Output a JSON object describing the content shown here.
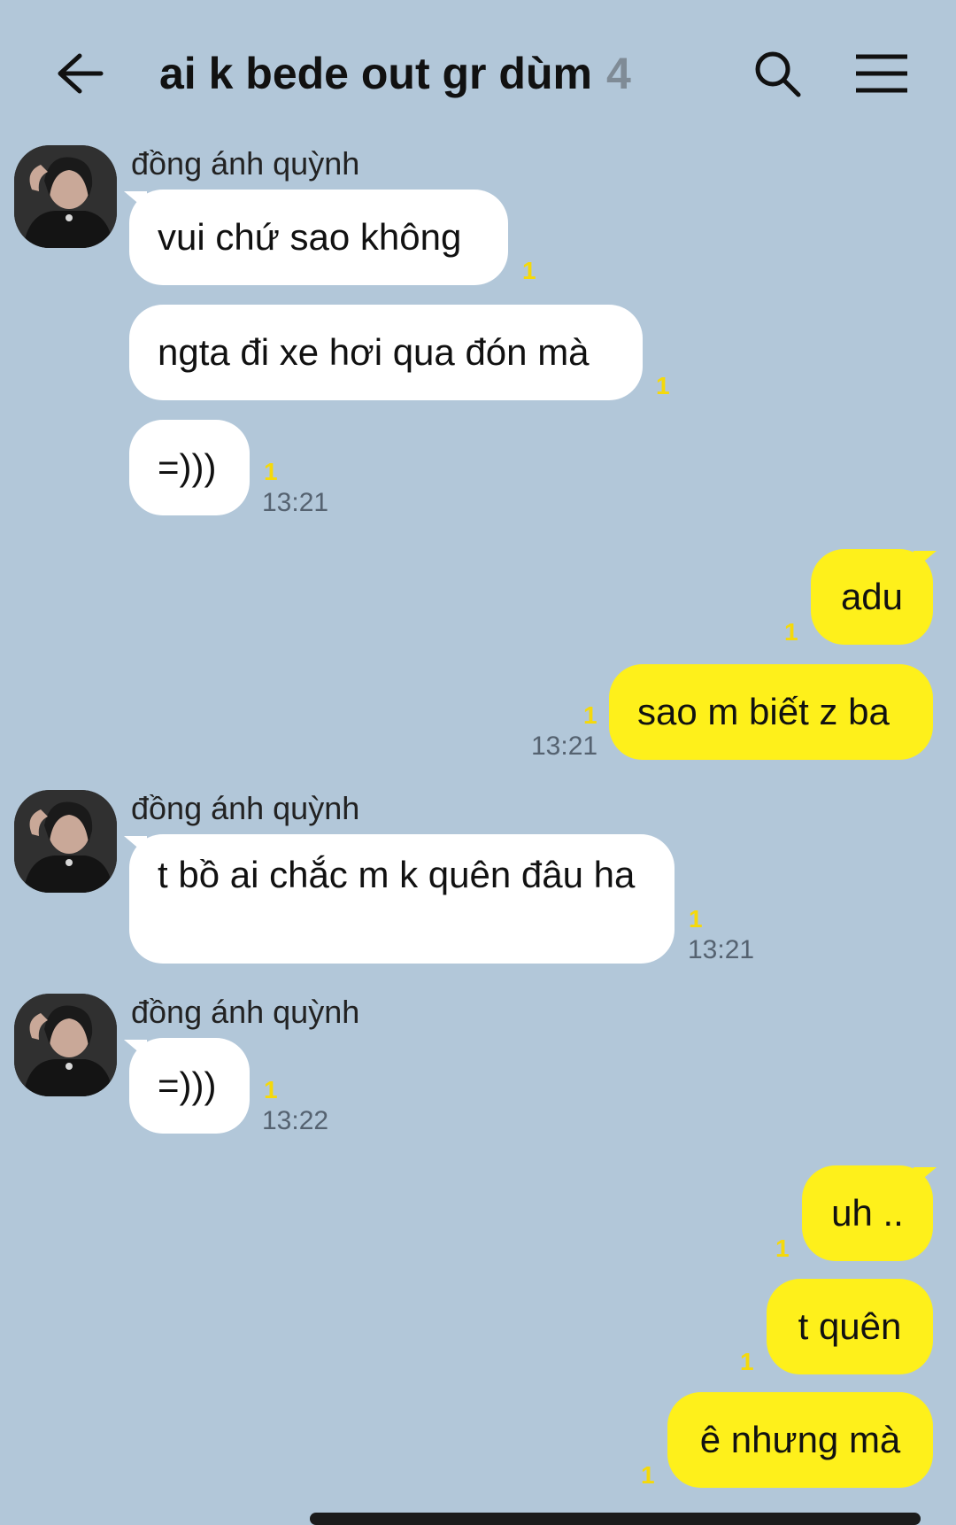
{
  "header": {
    "title": "ai k bede out gr dùm",
    "member_count": "4",
    "icons": {
      "back": "arrow-left-icon",
      "search": "search-icon",
      "menu": "hamburger-menu-icon"
    }
  },
  "colors": {
    "background": "#b2c7d9",
    "incoming_bubble": "#ffffff",
    "outgoing_bubble": "#fef01b",
    "unread_count": "#f5d90a"
  },
  "messages": [
    {
      "direction": "in",
      "sender": "đồng ánh quỳnh",
      "text": "vui chứ sao không",
      "unread": "1"
    },
    {
      "direction": "in",
      "text": "ngta đi xe hơi qua đón mà",
      "unread": "1"
    },
    {
      "direction": "in",
      "text": "=)))",
      "unread": "1",
      "time": "13:21"
    },
    {
      "direction": "out",
      "text": "adu",
      "unread": "1"
    },
    {
      "direction": "out",
      "text": "sao m biết z ba",
      "unread": "1",
      "time": "13:21"
    },
    {
      "direction": "in",
      "sender": "đồng ánh quỳnh",
      "text": "t bồ ai chắc m k quên đâu ha",
      "unread": "1",
      "time": "13:21"
    },
    {
      "direction": "in",
      "sender": "đồng ánh quỳnh",
      "text": "=)))",
      "unread": "1",
      "time": "13:22"
    },
    {
      "direction": "out",
      "text": "uh ..",
      "unread": "1"
    },
    {
      "direction": "out",
      "text": "t quên",
      "unread": "1"
    },
    {
      "direction": "out",
      "text": "ê nhưng mà",
      "unread": "1"
    }
  ]
}
